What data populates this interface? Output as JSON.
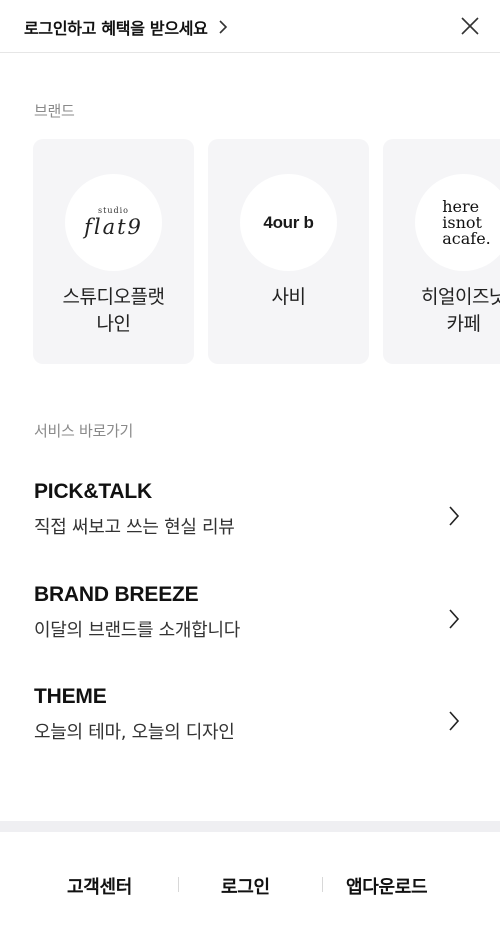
{
  "header": {
    "login_banner_text": "로그인하고 혜택을 받으세요",
    "chevron_icon": "chevron-right-icon",
    "close_icon": "close-icon"
  },
  "brands": {
    "label": "브랜드",
    "items": [
      {
        "name": "스튜디오플랫\n나인",
        "logo_small": "studio",
        "logo_main": "flat9"
      },
      {
        "name": "사비",
        "logo_text": "4our b"
      },
      {
        "name": "히얼이즈낫\n카페",
        "logo_lines": [
          "here",
          "isnot",
          "acafe."
        ]
      }
    ]
  },
  "services": {
    "label": "서비스 바로가기",
    "items": [
      {
        "title": "PICK&TALK",
        "description": "직접 써보고 쓰는 현실 리뷰"
      },
      {
        "title": "BRAND BREEZE",
        "description": "이달의 브랜드를 소개합니다"
      },
      {
        "title": "THEME",
        "description": "오늘의 테마, 오늘의 디자인"
      }
    ]
  },
  "footer": {
    "customer_center": "고객센터",
    "login": "로그인",
    "app_download": "앱다운로드"
  },
  "colors": {
    "card_background": "#f5f5f7",
    "section_label": "#8a8a8a",
    "divider": "#efeff2"
  }
}
